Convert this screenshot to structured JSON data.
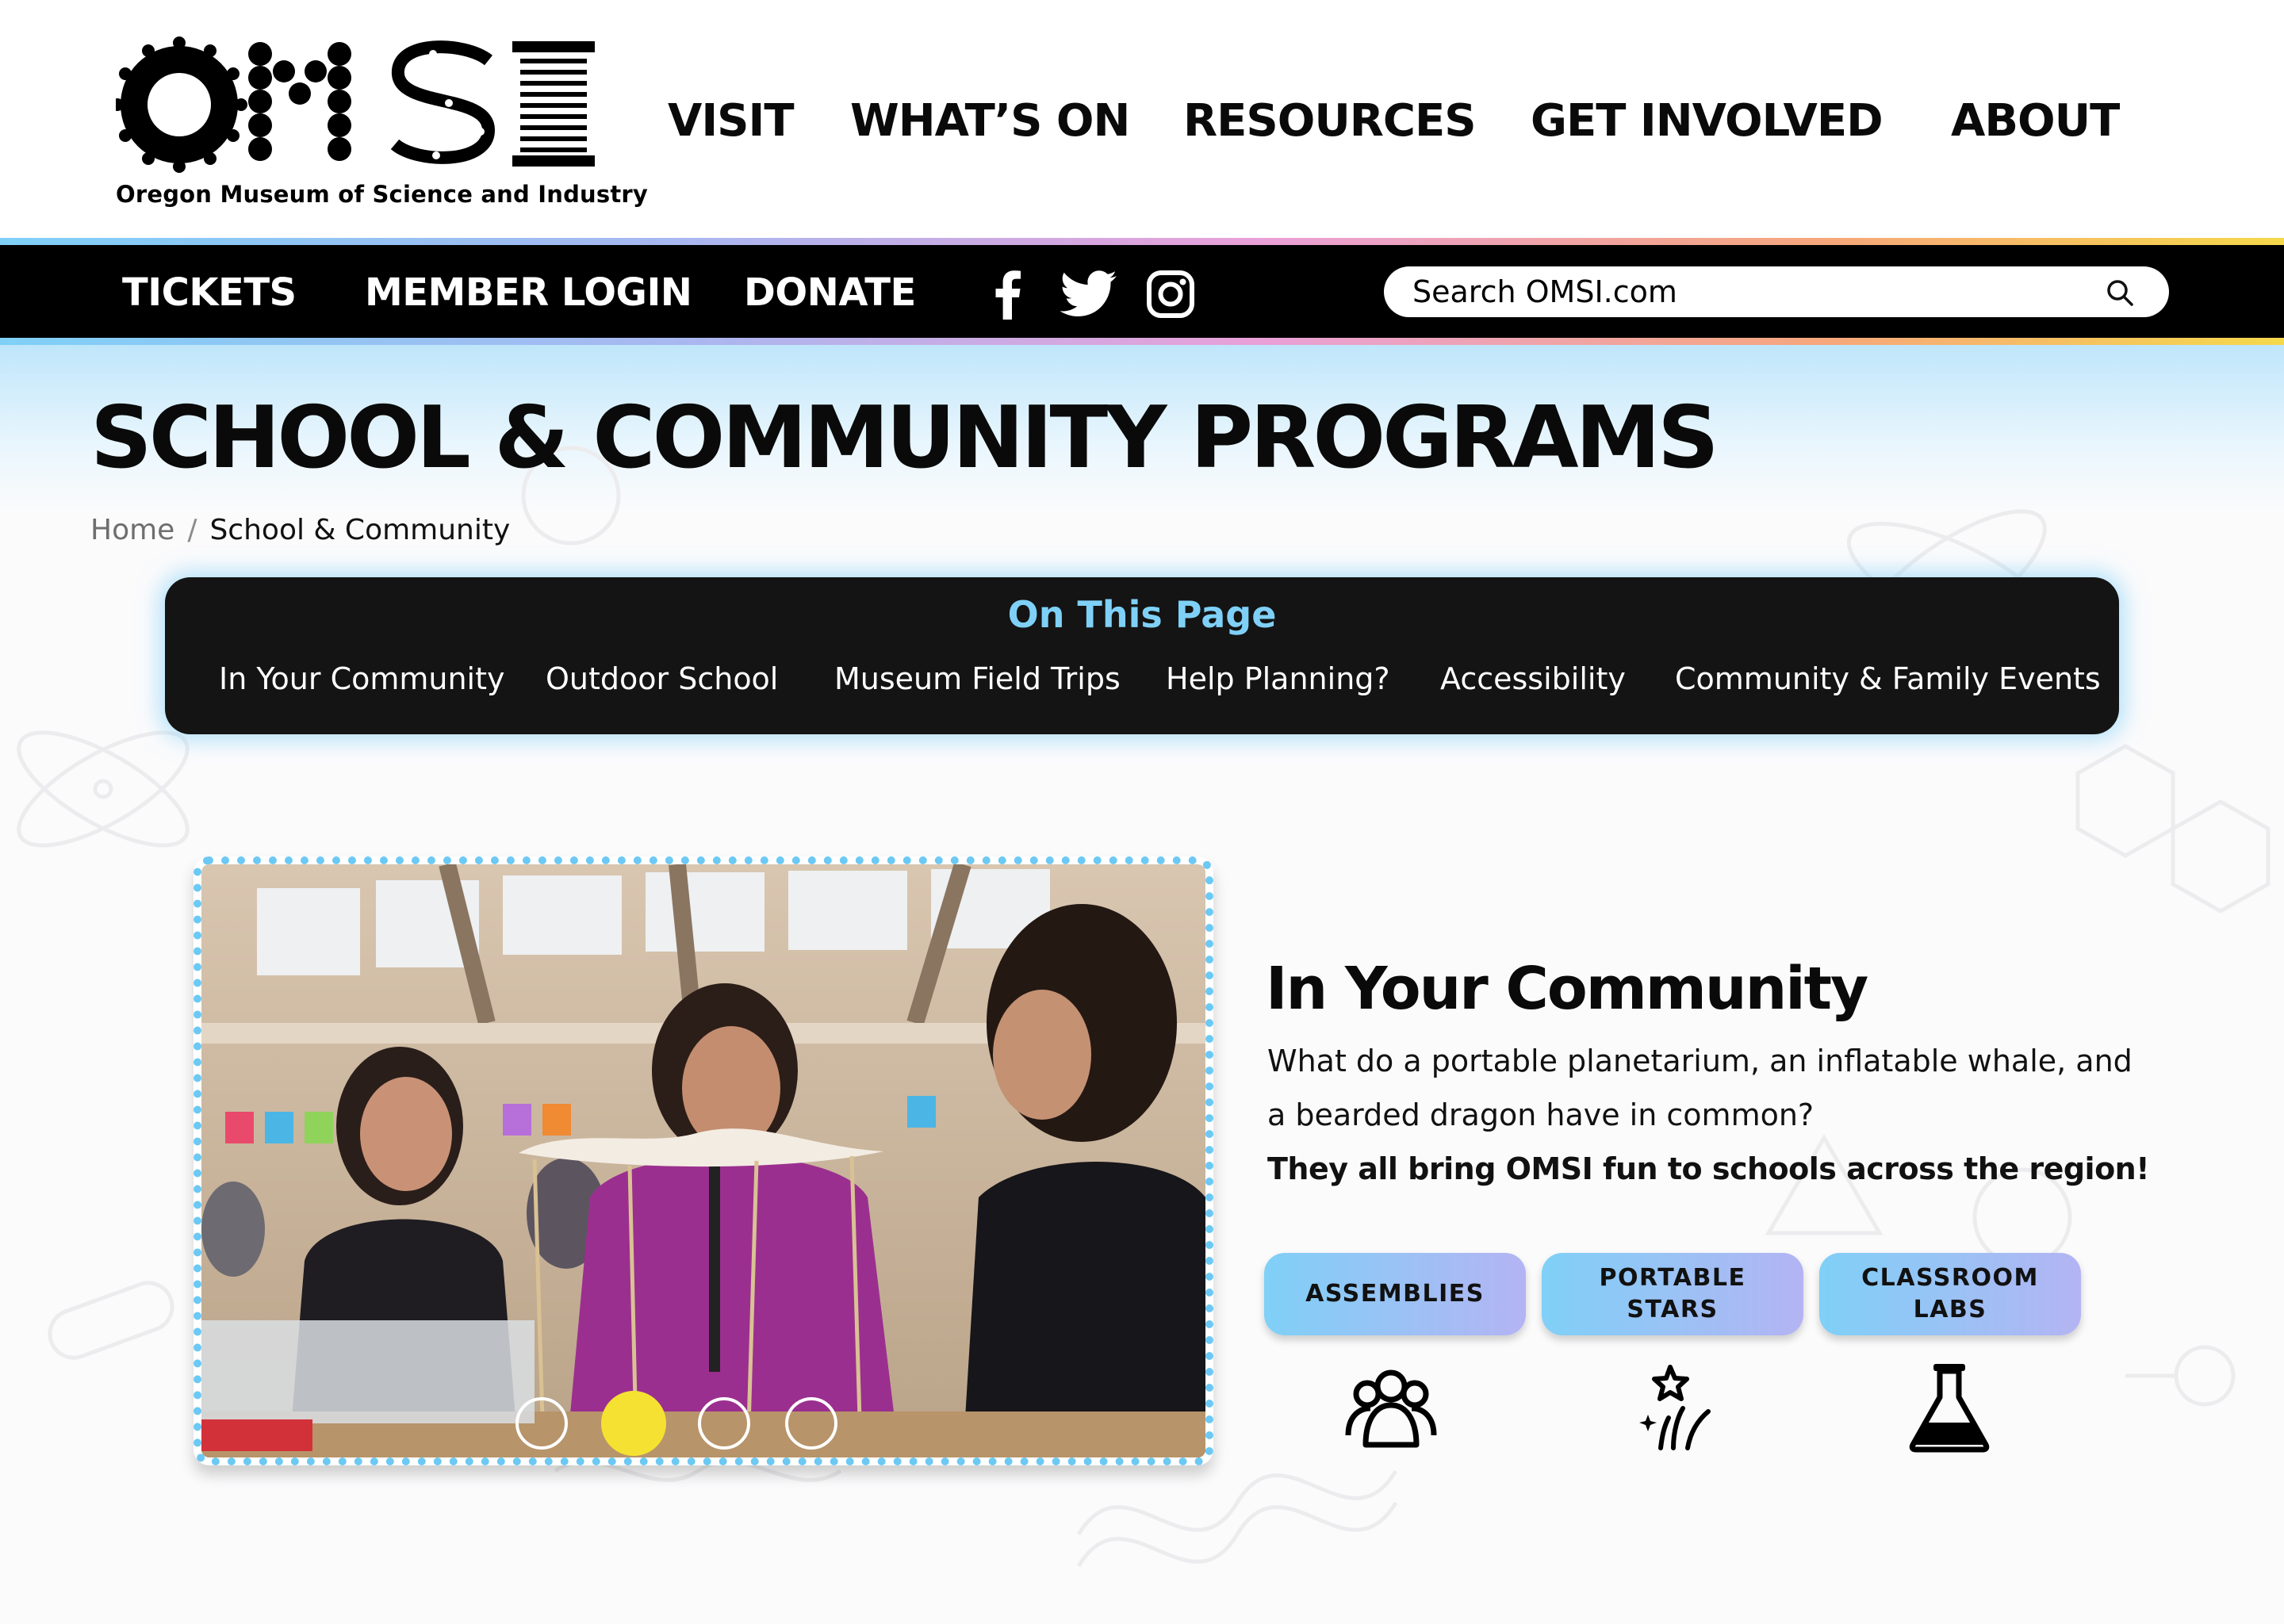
{
  "header": {
    "logo_text": "OMSI",
    "logo_tagline": "Oregon Museum of Science and Industry",
    "nav": [
      {
        "label": "VISIT"
      },
      {
        "label": "WHAT’S ON"
      },
      {
        "label": "RESOURCES"
      },
      {
        "label": "GET INVOLVED"
      },
      {
        "label": "ABOUT"
      }
    ]
  },
  "utility_bar": {
    "links": [
      {
        "label": "TICKETS"
      },
      {
        "label": "MEMBER LOGIN"
      },
      {
        "label": "DONATE"
      }
    ],
    "social_icons": [
      "facebook-icon",
      "twitter-icon",
      "instagram-icon"
    ],
    "search": {
      "placeholder": "Search OMSI.com"
    }
  },
  "page": {
    "title": "SCHOOL & COMMUNITY PROGRAMS",
    "breadcrumb": {
      "home": "Home",
      "separator": "/",
      "current": "School & Community"
    }
  },
  "on_this_page": {
    "title": "On This Page",
    "links": [
      {
        "label": "In Your Community"
      },
      {
        "label": "Outdoor School"
      },
      {
        "label": "Museum Field Trips"
      },
      {
        "label": "Help Planning?"
      },
      {
        "label": "Accessibility"
      },
      {
        "label": "Community & Family Events"
      }
    ]
  },
  "carousel": {
    "slide_count": 4,
    "active_slide": 2
  },
  "section": {
    "heading": "In Your Community",
    "text_line1": "What do a portable planetarium, an inflatable whale, and",
    "text_line2": "a bearded dragon have in common?",
    "bold_text": "They all bring OMSI fun to schools across the region!",
    "programs": [
      {
        "label_line1": "ASSEMBLIES",
        "label_line2": "",
        "icon": "group-people-icon"
      },
      {
        "label_line1": "PORTABLE",
        "label_line2": "STARS",
        "icon": "shooting-stars-icon"
      },
      {
        "label_line1": "CLASSROOM",
        "label_line2": "LABS",
        "icon": "flask-icon"
      }
    ]
  },
  "colors": {
    "accent_blue": "#7fd0f7",
    "accent_purple": "#b4b4f3",
    "carousel_dot_active": "#f5e132",
    "bar_black": "#000000"
  }
}
